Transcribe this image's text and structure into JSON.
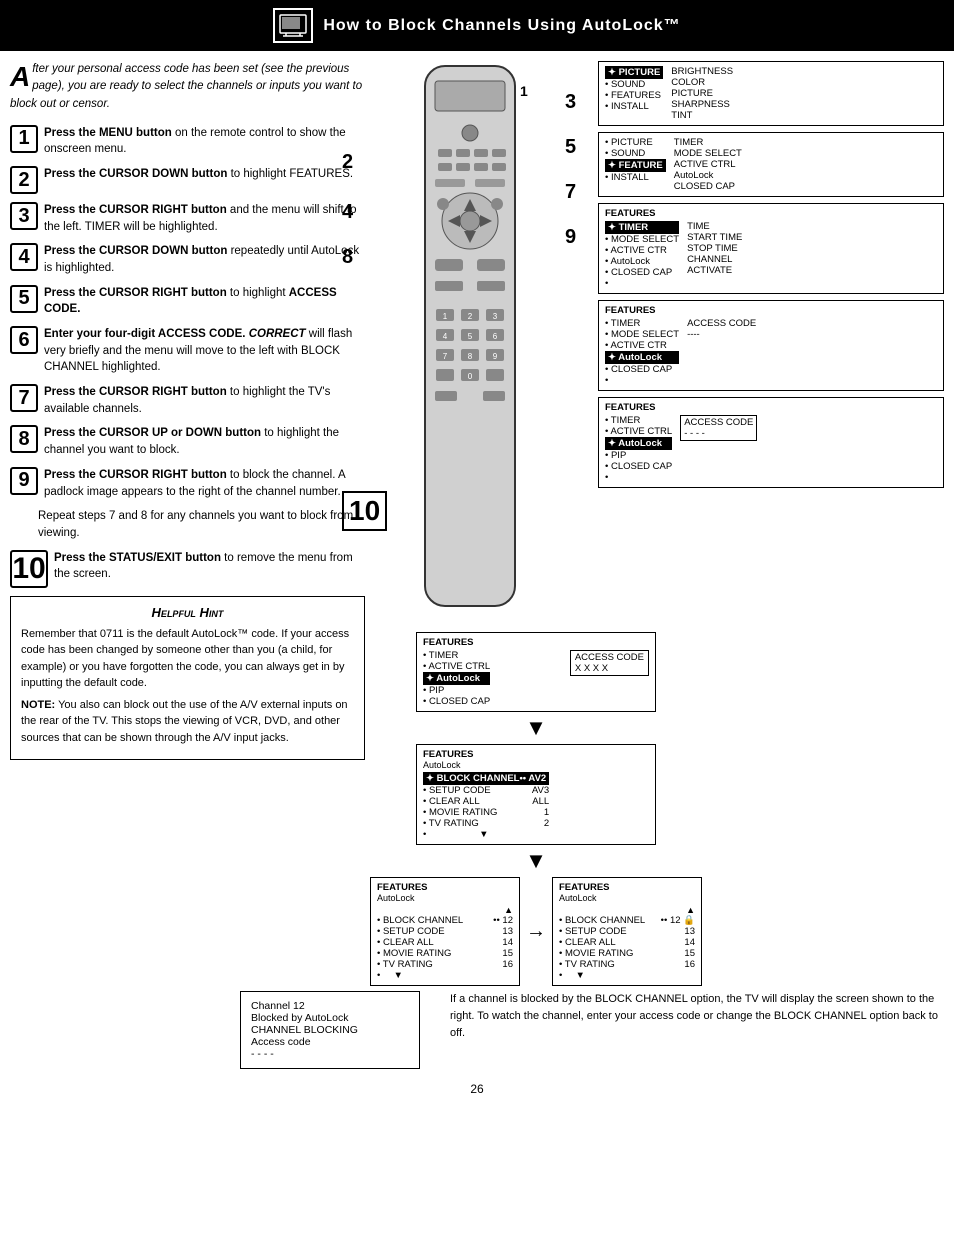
{
  "header": {
    "title": "How to Block Channels Using AutoLock™"
  },
  "intro": {
    "drop_cap": "A",
    "text": "fter your personal access code has been set (see the previous page), you are ready to select the channels or inputs you want to block out or censor."
  },
  "steps": [
    {
      "number": "1",
      "text_bold": "Press the MENU button",
      "text_rest": " on the remote control to show the onscreen menu."
    },
    {
      "number": "2",
      "text_bold": "Press the CURSOR DOWN button",
      "text_rest": " to highlight FEATURES."
    },
    {
      "number": "3",
      "text_bold": "Press the CURSOR RIGHT button",
      "text_rest": " and the menu will shift to the left. TIMER will be highlighted."
    },
    {
      "number": "4",
      "text_bold": "Press the CURSOR DOWN button",
      "text_rest": " repeatedly until AutoLock is highlighted."
    },
    {
      "number": "5",
      "text_bold": "Press the CURSOR RIGHT button",
      "text_rest": " to highlight ACCESS CODE."
    },
    {
      "number": "6",
      "text_bold": "Enter your four-digit ACCESS CODE.",
      "text_italic": " CORRECT",
      "text_rest2": " will flash very briefly and the menu will move to the left with BLOCK CHANNEL highlighted."
    },
    {
      "number": "7",
      "text_bold": "Press the CURSOR RIGHT button",
      "text_rest": " to highlight the TV's available channels."
    },
    {
      "number": "8",
      "text_bold": "Press the CURSOR UP or DOWN button",
      "text_rest": " to highlight the channel you want to block."
    },
    {
      "number": "9",
      "text_bold": "Press the CURSOR RIGHT button",
      "text_rest": " to block the channel. A padlock image appears to the right of the channel number."
    }
  ],
  "repeat_text": "Repeat steps 7 and 8 for any channels you want to block from viewing.",
  "step10": {
    "number": "10",
    "text_bold": "Press the STATUS/EXIT button",
    "text_rest": " to remove the menu from the screen."
  },
  "helpful_hint": {
    "title": "Helpful Hint",
    "paragraphs": [
      "Remember that 0711 is the default AutoLock™ code.  If your access code has been changed by someone other than you (a child, for example) or you have forgotten the code, you can always get in by inputting the default code.",
      "NOTE:  You also can block out the use of the A/V external inputs on the rear of the TV.  This stops the viewing of VCR, DVD, and other sources that can be shown through the A/V input jacks."
    ]
  },
  "menus": {
    "main_menu": {
      "title": "",
      "items": [
        {
          "label": "✦ PICTURE",
          "right": "BRIGHTNESS",
          "highlighted": true
        },
        {
          "label": "• SOUND",
          "right": "COLOR"
        },
        {
          "label": "• FEATURES",
          "right": "PICTURE"
        },
        {
          "label": "• INSTALL",
          "right": "SHARPNESS"
        },
        {
          "label": "",
          "right": "TINT"
        }
      ]
    },
    "main_menu2": {
      "title": "",
      "items": [
        {
          "label": "• PICTURE",
          "right": "TIMER"
        },
        {
          "label": "• SOUND",
          "right": "MODE SELECT"
        },
        {
          "label": "✦ FEATURE",
          "right": "ACTIVE CTRL",
          "highlighted": true
        },
        {
          "label": "• INSTALL",
          "right": "AutoLock"
        },
        {
          "label": "",
          "right": "CLOSED CAP"
        }
      ]
    },
    "features_timer": {
      "title": "FEATURES",
      "items": [
        {
          "label": "✦ TIMER",
          "right": "TIME",
          "highlighted": true
        },
        {
          "label": "• MODE SELECT",
          "right": "START TIME"
        },
        {
          "label": "• ACTIVE CTR",
          "right": "STOP TIME"
        },
        {
          "label": "• AutoLock",
          "right": "CHANNEL"
        },
        {
          "label": "• CLOSED CAP",
          "right": "ACTIVATE"
        },
        {
          "label": "•",
          "right": ""
        }
      ]
    },
    "features_autolock": {
      "title": "FEATURES",
      "items": [
        {
          "label": "• TIMER",
          "right": "ACCESS CODE"
        },
        {
          "label": "• MODE SELECT",
          "right": "----"
        },
        {
          "label": "• ACTIVE CTR",
          "right": ""
        },
        {
          "label": "✦ AutoLock",
          "right": "",
          "highlighted": true
        },
        {
          "label": "• CLOSED CAP",
          "right": ""
        },
        {
          "label": "•",
          "right": ""
        }
      ]
    },
    "features_access_entry": {
      "title": "FEATURES",
      "items": [
        {
          "label": "• TIMER",
          "right": "ACCESS CODE"
        },
        {
          "label": "• ACTIVE CTRL",
          "right": ""
        },
        {
          "label": "✦ AutoLock",
          "right": "",
          "highlighted": true
        },
        {
          "label": "• PIP",
          "right": ""
        },
        {
          "label": "• CLOSED CAP",
          "right": ""
        },
        {
          "label": "•",
          "right": ""
        }
      ],
      "access_code_value": "- - - -"
    },
    "autolock_block_channel": {
      "title": "FEATURES",
      "subtitle": "AutoLock",
      "items": [
        {
          "label": "✦ BLOCK CHANNEL",
          "right": "•• AV2",
          "highlighted": true
        },
        {
          "label": "• SETUP CODE",
          "right": "AV3"
        },
        {
          "label": "• CLEAR ALL",
          "right": "ALL"
        },
        {
          "label": "• MOVIE RATING",
          "right": "1"
        },
        {
          "label": "• TV RATING",
          "right": "2"
        },
        {
          "label": "•",
          "right": "▼"
        }
      ],
      "access_code_label": "ACCESS CODE",
      "access_code_value": "X X X X"
    },
    "autolock_channels_unlocked": {
      "title": "FEATURES",
      "subtitle": "AutoLock",
      "items": [
        {
          "label": "• BLOCK CHANNEL",
          "right": "•• 12"
        },
        {
          "label": "• SETUP CODE",
          "right": "13"
        },
        {
          "label": "• CLEAR ALL",
          "right": "14"
        },
        {
          "label": "• MOVIE RATING",
          "right": "15"
        },
        {
          "label": "• TV RATING",
          "right": "16"
        },
        {
          "label": "•",
          "right": "▼"
        }
      ],
      "header_arrow": "▲"
    },
    "autolock_channels_locked": {
      "title": "FEATURES",
      "subtitle": "AutoLock",
      "items": [
        {
          "label": "• BLOCK CHANNEL",
          "right": "•• 12 🔒"
        },
        {
          "label": "• SETUP CODE",
          "right": "13"
        },
        {
          "label": "• CLEAR ALL",
          "right": "14"
        },
        {
          "label": "• MOVIE RATING",
          "right": "15"
        },
        {
          "label": "• TV RATING",
          "right": "16"
        },
        {
          "label": "•",
          "right": "▼"
        }
      ],
      "header_arrow": "▲"
    },
    "features_access_xxxx": {
      "title": "FEATURES",
      "items": [
        {
          "label": "• TIMER",
          "right": ""
        },
        {
          "label": "• ACTIVE CTRL",
          "right": ""
        },
        {
          "label": "✦ AutoLock",
          "right": "",
          "highlighted": true
        },
        {
          "label": "• PIP",
          "right": ""
        },
        {
          "label": "• CLOSED CAP",
          "right": ""
        }
      ],
      "access_code_label": "ACCESS CODE",
      "access_code_value": "X X X X"
    }
  },
  "blocking_screen": {
    "line1": "Channel 12",
    "line2": "Blocked by AutoLock",
    "line3": "CHANNEL BLOCKING",
    "line4": "Access code",
    "line5": "- - - -"
  },
  "final_text": "If a channel is blocked by the BLOCK CHANNEL option, the TV will display the screen shown to the right. To watch the channel, enter your access code or change the BLOCK CHANNEL option back to off.",
  "page_number": "26"
}
